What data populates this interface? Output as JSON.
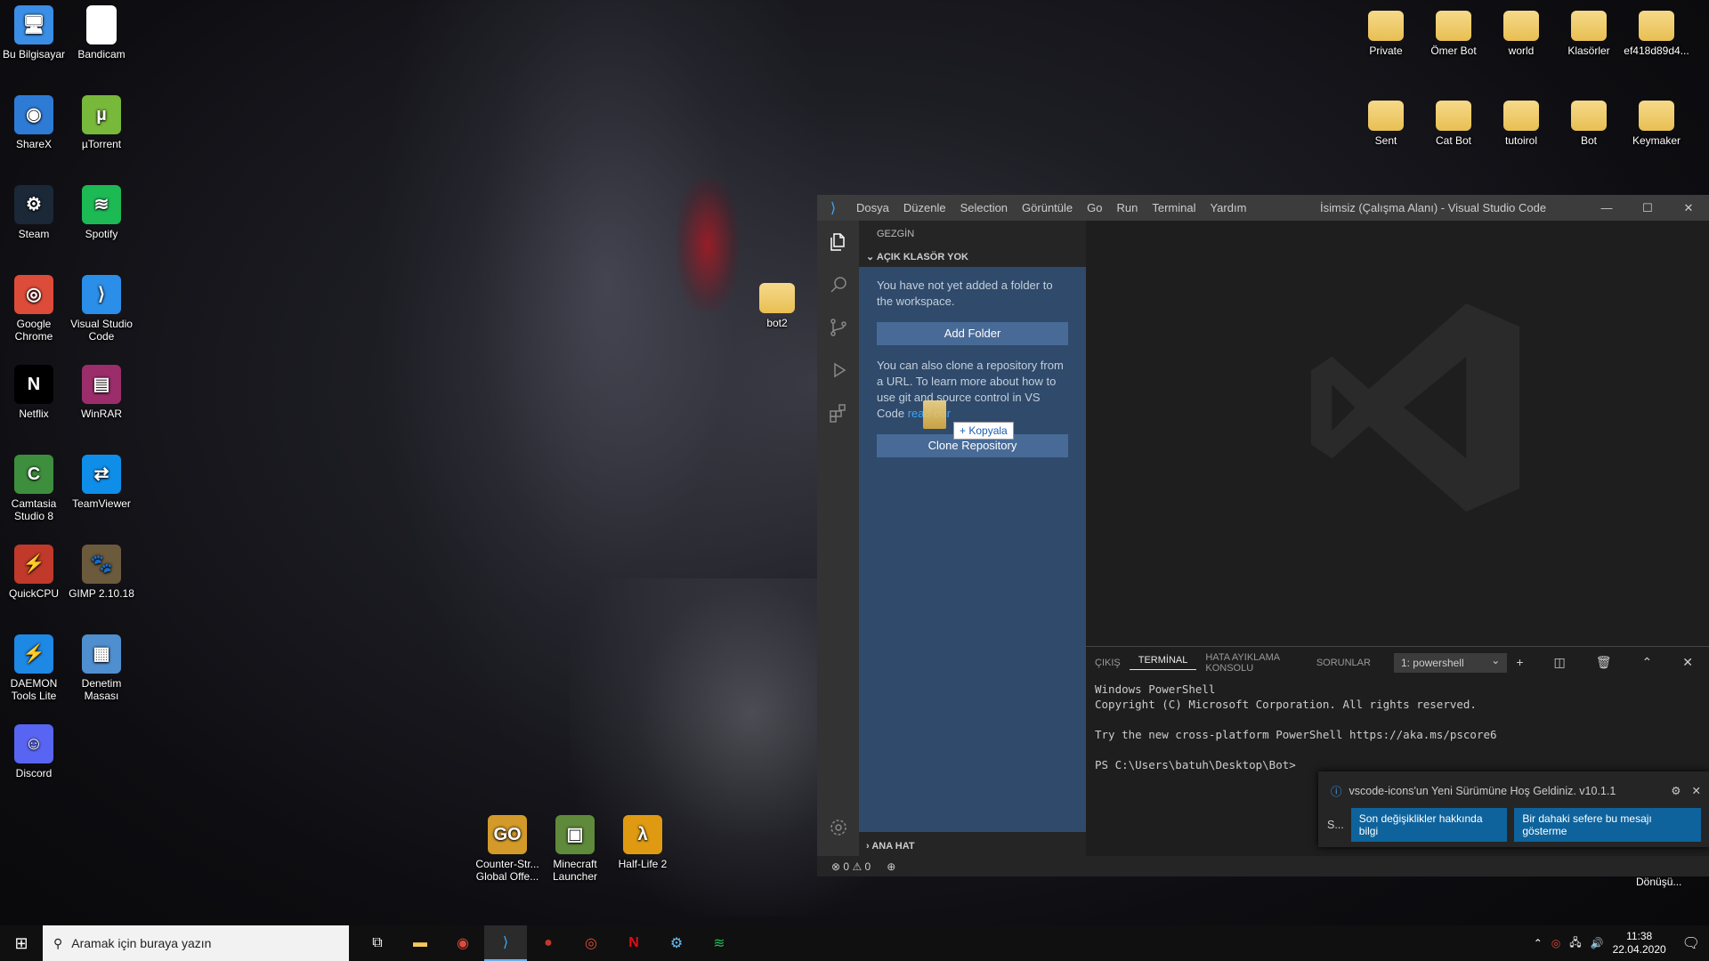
{
  "desktop_left": [
    {
      "label": "Bu Bilgisayar",
      "icon": "computer-icon",
      "color": "#3a8ee6",
      "glyph": "🖥"
    },
    {
      "label": "Bandicam",
      "icon": "bandicam-icon",
      "color": "#ffffff",
      "glyph": ""
    },
    {
      "label": "ShareX",
      "icon": "sharex-icon",
      "color": "#2e7bd6",
      "glyph": "◉"
    },
    {
      "label": "µTorrent",
      "icon": "utorrent-icon",
      "color": "#78b83a",
      "glyph": "µ"
    },
    {
      "label": "Steam",
      "icon": "steam-icon",
      "color": "#1b2838",
      "glyph": "⚙"
    },
    {
      "label": "Spotify",
      "icon": "spotify-icon",
      "color": "#1db954",
      "glyph": "≋"
    },
    {
      "label": "Google Chrome",
      "icon": "chrome-icon",
      "color": "#dd4b39",
      "glyph": "◎"
    },
    {
      "label": "Visual Studio Code",
      "icon": "vscode-icon",
      "color": "#2b8ee8",
      "glyph": "⟩"
    },
    {
      "label": "Netflix",
      "icon": "netflix-icon",
      "color": "#000000",
      "glyph": "N"
    },
    {
      "label": "WinRAR",
      "icon": "winrar-icon",
      "color": "#9b2d6b",
      "glyph": "▤"
    },
    {
      "label": "Camtasia Studio 8",
      "icon": "camtasia-icon",
      "color": "#3d8f3d",
      "glyph": "C"
    },
    {
      "label": "TeamViewer",
      "icon": "teamviewer-icon",
      "color": "#0e8ee9",
      "glyph": "⇄"
    },
    {
      "label": "QuickCPU",
      "icon": "quickcpu-icon",
      "color": "#c0392b",
      "glyph": "⚡"
    },
    {
      "label": "GIMP 2.10.18",
      "icon": "gimp-icon",
      "color": "#6b5a3c",
      "glyph": "🐾"
    },
    {
      "label": "DAEMON Tools Lite",
      "icon": "daemon-tools-icon",
      "color": "#1e88e5",
      "glyph": "⚡"
    },
    {
      "label": "Denetim Masası",
      "icon": "control-panel-icon",
      "color": "#4f8fcf",
      "glyph": "▦"
    },
    {
      "label": "Discord",
      "icon": "discord-icon",
      "color": "#5865f2",
      "glyph": "☺"
    }
  ],
  "desktop_right": [
    {
      "label": "Private"
    },
    {
      "label": "Ömer Bot"
    },
    {
      "label": "world"
    },
    {
      "label": "Klasörler"
    },
    {
      "label": "ef418d89d4..."
    },
    {
      "label": "Sent"
    },
    {
      "label": "Cat Bot"
    },
    {
      "label": "tutoirol"
    },
    {
      "label": "Bot"
    },
    {
      "label": "Keymaker"
    }
  ],
  "desktop_games": [
    {
      "label": "Counter-Str... Global Offe...",
      "icon": "csgo-icon",
      "color": "#d39a2a",
      "glyph": "GO"
    },
    {
      "label": "Minecraft Launcher",
      "icon": "minecraft-icon",
      "color": "#5f8a3b",
      "glyph": "▣"
    },
    {
      "label": "Half-Life 2",
      "icon": "half-life-icon",
      "color": "#e09a12",
      "glyph": "λ"
    }
  ],
  "desktop_bot2": "bot2",
  "vscode": {
    "menu": [
      "Dosya",
      "Düzenle",
      "Selection",
      "Görüntüle",
      "Go",
      "Run",
      "Terminal",
      "Yardım"
    ],
    "window_title": "İsimsiz (Çalışma Alanı) - Visual Studio Code",
    "explorer_header": "GEZGİN",
    "section_title": "AÇIK KLASÖR YOK",
    "welcome_text_1": "You have not yet added a folder to the workspace.",
    "add_folder": "Add Folder",
    "welcome_text_2": "You can also clone a repository from a URL. To learn more about how to use git and source control in VS Code",
    "read_link": "read our",
    "clone_repo": "Clone Repository",
    "drag_tip": "+ Kopyala",
    "outline": "ANA HAT",
    "panel_tabs": [
      "ÇIKIŞ",
      "TERMİNAL",
      "HATA AYIKLAMA KONSOLU",
      "SORUNLAR"
    ],
    "terminal_select": "1: powershell",
    "terminal_lines": "Windows PowerShell\nCopyright (C) Microsoft Corporation. All rights reserved.\n\nTry the new cross-platform PowerShell https://aka.ms/pscore6\n\nPS C:\\Users\\batuh\\Desktop\\Bot>",
    "notification": "vscode-icons'un Yeni Sürümüne Hoş Geldiniz. v10.1.1",
    "notif_prefix": "S...",
    "notif_btn_1": "Son değişiklikler hakkında bilgi",
    "notif_btn_2": "Bir dahaki sefere bu mesajı gösterme",
    "status_errors": "0",
    "status_warnings": "0",
    "behind_text": "Dönüşü..."
  },
  "taskbar": {
    "search_placeholder": "Aramak için buraya yazın",
    "time": "11:38",
    "date": "22.04.2020"
  }
}
